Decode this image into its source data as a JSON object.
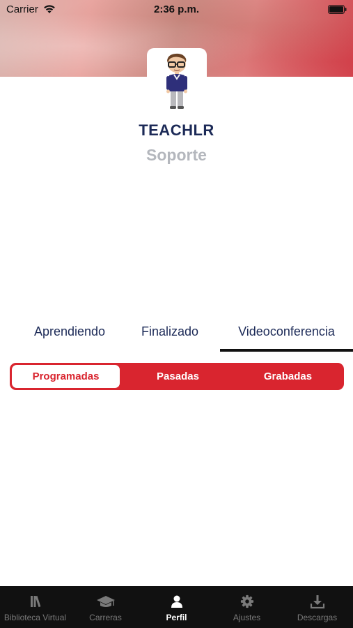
{
  "status_bar": {
    "carrier": "Carrier",
    "time": "2:36 p.m."
  },
  "profile": {
    "name": "TEACHLR",
    "role": "Soporte"
  },
  "tabs": [
    {
      "label": "Aprendiendo"
    },
    {
      "label": "Finalizado"
    },
    {
      "label": "Videoconferencia",
      "selected": true
    }
  ],
  "segments": [
    {
      "label": "Programadas",
      "selected": true
    },
    {
      "label": "Pasadas"
    },
    {
      "label": "Grabadas"
    }
  ],
  "tab_bar": [
    {
      "label": "Biblioteca Virtual",
      "icon": "books-icon"
    },
    {
      "label": "Carreras",
      "icon": "graduation-cap-icon"
    },
    {
      "label": "Perfil",
      "icon": "person-icon",
      "active": true
    },
    {
      "label": "Ajustes",
      "icon": "gear-icon"
    },
    {
      "label": "Descargas",
      "icon": "download-icon"
    }
  ],
  "colors": {
    "accent": "#d9252f",
    "navy": "#1c2a57",
    "muted": "#b4b7bd",
    "tabbar_bg": "#111111"
  }
}
